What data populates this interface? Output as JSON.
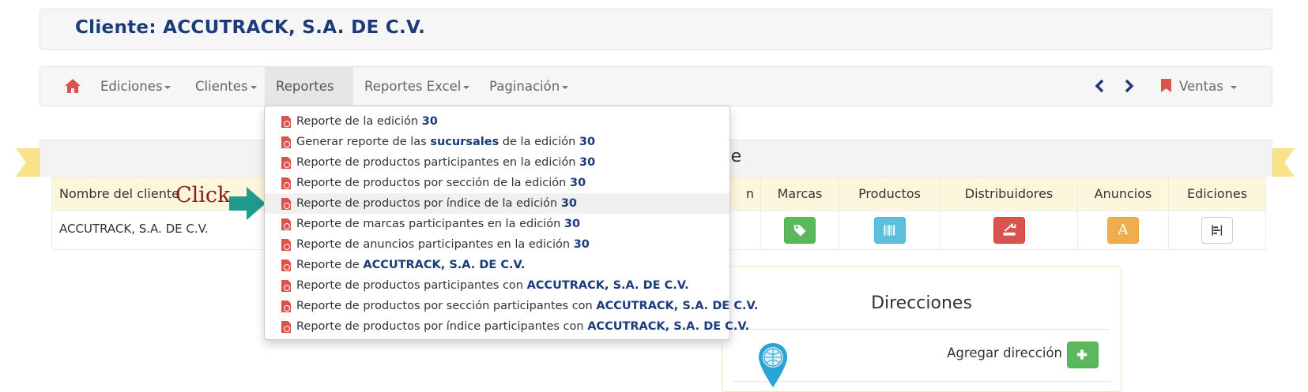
{
  "header": {
    "title": "Cliente: ACCUTRACK, S.A. DE C.V."
  },
  "navbar": {
    "items": [
      {
        "label": "Ediciones"
      },
      {
        "label": "Clientes"
      },
      {
        "label": "Reportes"
      },
      {
        "label": "Reportes Excel"
      },
      {
        "label": "Paginación"
      }
    ],
    "active": "Reportes",
    "right_menu": "Ventas"
  },
  "panel": {
    "title_visible": "nte"
  },
  "table": {
    "headers": [
      "Nombre del cliente",
      "n",
      "Marcas",
      "Productos",
      "Distribuidores",
      "Anuncios",
      "Ediciones"
    ],
    "row": {
      "name": "ACCUTRACK, S.A. DE C.V.",
      "anuncios_glyph": "A"
    }
  },
  "dropdown": {
    "items": [
      {
        "text": "Reporte de la edición ",
        "bold": "30",
        "suffix": ""
      },
      {
        "text": "Generar reporte de las ",
        "bold": "sucursales",
        "suffix": " de la edición ",
        "bold2": "30"
      },
      {
        "text": "Reporte de productos participantes en la edición ",
        "bold": "30",
        "suffix": ""
      },
      {
        "text": "Reporte de productos por sección de la edición ",
        "bold": "30",
        "suffix": ""
      },
      {
        "text": "Reporte de productos por índice de la edición ",
        "bold": "30",
        "suffix": ""
      },
      {
        "text": "Reporte de marcas participantes en la edición ",
        "bold": "30",
        "suffix": ""
      },
      {
        "text": "Reporte de anuncios participantes en la edición ",
        "bold": "30",
        "suffix": ""
      },
      {
        "text": "Reporte de ",
        "bold": "ACCUTRACK, S.A. DE C.V.",
        "suffix": ""
      },
      {
        "text": "Reporte de productos participantes con ",
        "bold": "ACCUTRACK, S.A. DE C.V.",
        "suffix": ""
      },
      {
        "text": "Reporte de productos por sección participantes con ",
        "bold": "ACCUTRACK, S.A. DE C.V.",
        "suffix": ""
      },
      {
        "text": "Reporte de productos por índice participantes con ",
        "bold": "ACCUTRACK, S.A. DE C.V.",
        "suffix": ""
      }
    ]
  },
  "annotation": {
    "click_label": "Click"
  },
  "direcciones": {
    "title": "Direcciones",
    "add_label": "Agregar dirección"
  },
  "colors": {
    "brand_blue": "#1b3b7a",
    "danger": "#d9534f",
    "success": "#5cb85c",
    "info": "#5bc0de",
    "warning": "#f0ad4e",
    "teal_arrow": "#1f9a8e"
  }
}
